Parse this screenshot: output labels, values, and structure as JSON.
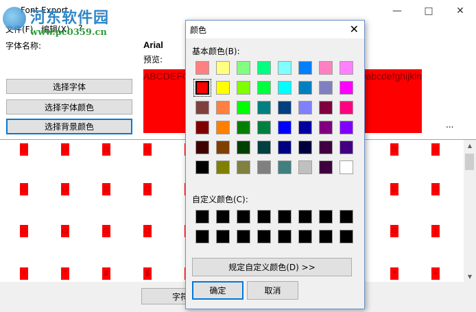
{
  "window": {
    "title": "Font Export",
    "menus": [
      "文件(F)",
      "编辑(X)",
      "?"
    ]
  },
  "watermark": {
    "title": "河东软件园",
    "url": "www.pc0359.cn"
  },
  "main": {
    "font_name_label": "字体名称:",
    "font_name": "Arial",
    "preview_label": "预览:",
    "preview_text": "ABCDEFGHIJKLMNOPQRSTUVWXYZ1234567890abcdefghijklmnopqrstuvwxyz",
    "select_font_button": "选择字体",
    "select_font_color_button": "选择字体颜色",
    "select_bg_color_button": "选择背景颜色",
    "ellipsis": "...",
    "bottom_button": "字符",
    "glyph_rows": [
      [
        "□",
        "□",
        "□",
        "□",
        "□",
        "□",
        "□",
        "□",
        "□",
        "□",
        "□"
      ],
      [
        "□",
        "□",
        "□",
        "□",
        "□",
        "□",
        "□",
        "□",
        "□",
        "□",
        "□"
      ],
      [
        "□",
        "□",
        "□",
        "□",
        "□",
        "□",
        "□",
        "□",
        "□",
        "□",
        "|"
      ],
      [
        "!",
        "\"",
        "#",
        "$",
        "%",
        "&",
        "'",
        "(",
        ")",
        "*",
        "+"
      ]
    ]
  },
  "color_dialog": {
    "title": "颜色",
    "basic_label": "基本颜色(B):",
    "custom_label": "自定义颜色(C):",
    "define_button": "规定自定义颜色(D) >>",
    "ok_button": "确定",
    "cancel_button": "取消",
    "selected_index": 8,
    "basic_colors": [
      "#ff8080",
      "#ffff80",
      "#80ff80",
      "#00ff80",
      "#80ffff",
      "#0080ff",
      "#ff80c0",
      "#ff80ff",
      "#ff0000",
      "#ffff00",
      "#80ff00",
      "#00ff40",
      "#00ffff",
      "#0080c0",
      "#8080c0",
      "#ff00ff",
      "#804040",
      "#ff8040",
      "#00ff00",
      "#008080",
      "#004080",
      "#8080ff",
      "#800040",
      "#ff0080",
      "#800000",
      "#ff8000",
      "#008000",
      "#008040",
      "#0000ff",
      "#0000a0",
      "#800080",
      "#8000ff",
      "#400000",
      "#804000",
      "#004000",
      "#004040",
      "#000080",
      "#000040",
      "#400040",
      "#400080",
      "#000000",
      "#808000",
      "#808040",
      "#808080",
      "#408080",
      "#c0c0c0",
      "#400040",
      "#ffffff"
    ],
    "custom_colors": [
      "#000000",
      "#000000",
      "#000000",
      "#000000",
      "#000000",
      "#000000",
      "#000000",
      "#000000",
      "#000000",
      "#000000",
      "#000000",
      "#000000",
      "#000000",
      "#000000",
      "#000000",
      "#000000"
    ]
  }
}
